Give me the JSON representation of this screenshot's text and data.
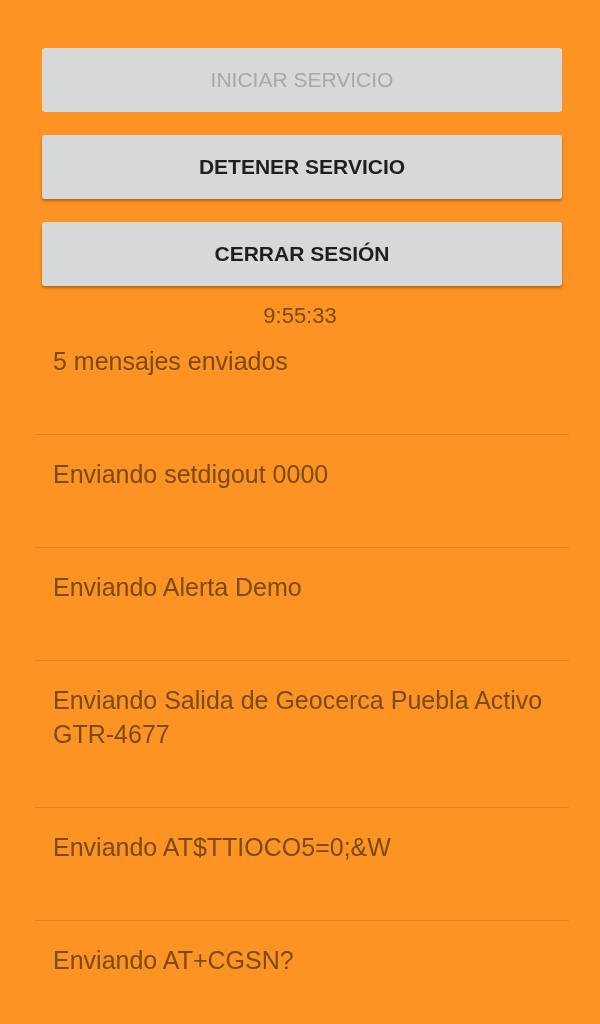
{
  "buttons": [
    {
      "label": "INICIAR SERVICIO",
      "disabled": true
    },
    {
      "label": "DETENER SERVICIO",
      "disabled": false
    },
    {
      "label": "CERRAR SESIÓN",
      "disabled": false
    }
  ],
  "time": "9:55:33",
  "messages": [
    {
      "text": "5 mensajes enviados"
    },
    {
      "text": "Enviando setdigout 0000"
    },
    {
      "text": "Enviando Alerta Demo"
    },
    {
      "text": "Enviando Salida de Geocerca Puebla Activo GTR-4677"
    },
    {
      "text": "Enviando AT$TTIOCO5=0;&W"
    },
    {
      "text": "Enviando AT+CGSN?"
    }
  ]
}
